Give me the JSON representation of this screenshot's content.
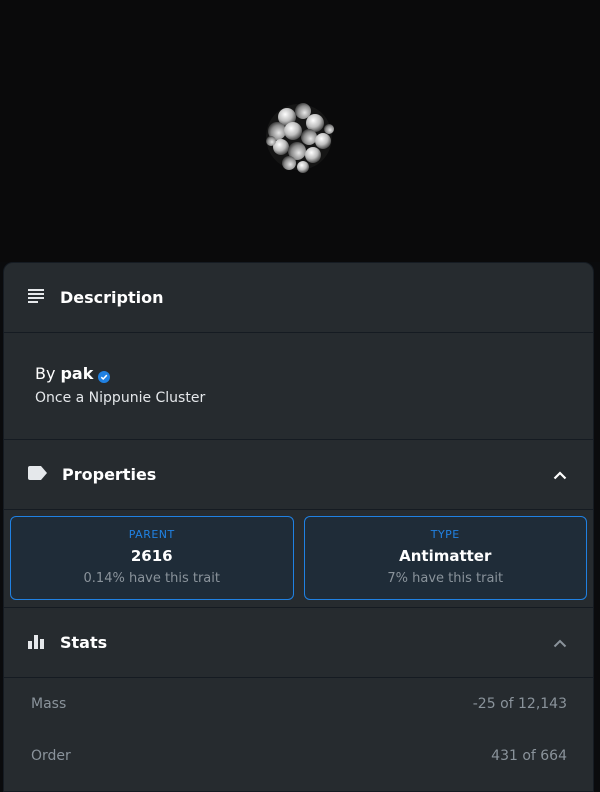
{
  "description": {
    "title": "Description",
    "by_prefix": "By",
    "creator": "pak",
    "text": "Once a Nippunie Cluster"
  },
  "properties": {
    "title": "Properties",
    "items": [
      {
        "type": "PARENT",
        "value": "2616",
        "rarity": "0.14% have this trait"
      },
      {
        "type": "TYPE",
        "value": "Antimatter",
        "rarity": "7% have this trait"
      }
    ]
  },
  "stats": {
    "title": "Stats",
    "items": [
      {
        "label": "Mass",
        "value": "-25 of 12,143"
      },
      {
        "label": "Order",
        "value": "431 of 664"
      }
    ]
  },
  "icons": {
    "description": "description-lines-icon",
    "properties": "label-tag-icon",
    "stats": "bar-chart-icon",
    "collapse": "chevron-up-icon",
    "verified": "verified-badge-icon"
  },
  "colors": {
    "accent": "#2081e2",
    "panel": "#262b2f",
    "card": "#1f2c38"
  }
}
